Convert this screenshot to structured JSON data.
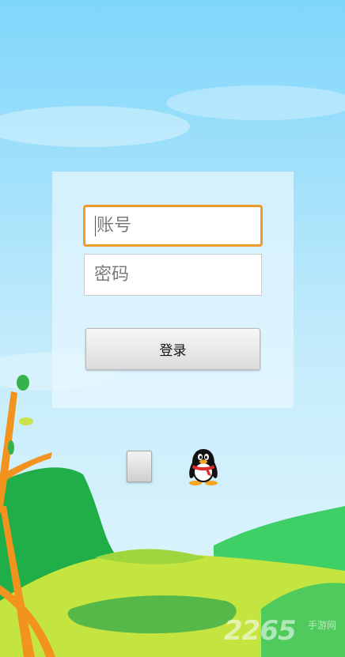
{
  "login_form": {
    "account_placeholder": "账号",
    "password_placeholder": "密码",
    "login_label": "登录"
  },
  "remember_checkbox": {
    "checked": false
  },
  "qq_login": {
    "icon": "qq-penguin-icon"
  },
  "watermark": {
    "digits": "2265",
    "text": "手游网"
  },
  "colors": {
    "sky_top": "#87d8fa",
    "sky_bottom": "#d5f1fb",
    "focus_border": "#f09a2a",
    "hill_dark": "#22b14c",
    "hill_light": "#c8e64a",
    "tree_orange": "#f2931f"
  }
}
